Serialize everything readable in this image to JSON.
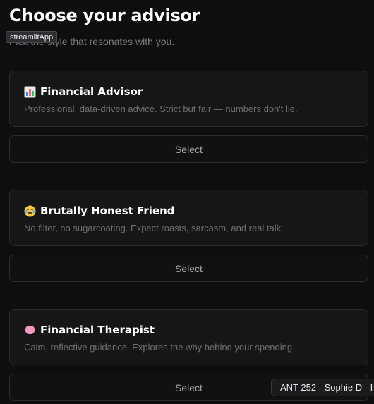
{
  "header": {
    "title": "Choose your advisor",
    "subtitle": "Pick the style that resonates with you.",
    "tooltip": "streamlitApp"
  },
  "advisors": [
    {
      "icon": "bar-chart-icon",
      "title": "Financial Advisor",
      "description": "Professional, data-driven advice. Strict but fair — numbers don't lie.",
      "button_label": "Select"
    },
    {
      "icon": "laughing-face-icon",
      "title": "Brutally Honest Friend",
      "description": "No filter, no sugarcoating. Expect roasts, sarcasm, and real talk.",
      "button_label": "Select"
    },
    {
      "icon": "brain-icon",
      "title": "Financial Therapist",
      "description": "Calm, reflective guidance. Explores the why behind your spending.",
      "button_label": "Select"
    }
  ],
  "overlay": {
    "taskbar_label": "ANT 252 - Sophie D - I"
  },
  "colors": {
    "background": "#0e0e0f",
    "card": "#161617",
    "border": "#2c2c2f",
    "muted_text": "#6f6f75"
  }
}
